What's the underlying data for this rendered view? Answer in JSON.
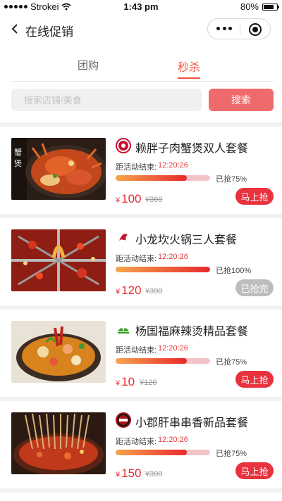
{
  "status_bar": {
    "carrier": "Strokei",
    "time": "1:43 pm",
    "battery": "80%",
    "battery_level": 0.8
  },
  "nav": {
    "title": "在线促销"
  },
  "tabs": [
    {
      "label": "团购"
    },
    {
      "label": "秒杀"
    }
  ],
  "active_tab": "秒杀",
  "search": {
    "placeholder": "搜索店铺/美食",
    "value": "",
    "button_label": "搜索"
  },
  "deals": [
    {
      "title": "赖胖子肉蟹煲双人套餐",
      "countdown_label": "距活动结束:",
      "countdown": "12:20:26",
      "progress": 0.75,
      "progress_text": "已抢75%",
      "currency": "¥",
      "price": "100",
      "original_price": "¥390",
      "button_label": "马上抢",
      "status": "active",
      "image_icon": "crab-pot-image",
      "logo_icon": "crab-restaurant-logo-icon",
      "accent": "#c8102e"
    },
    {
      "title": "小龙坎火锅三人套餐",
      "countdown_label": "距活动结束:",
      "countdown": "12:20:26",
      "progress": 1.0,
      "progress_text": "已抢100%",
      "currency": "¥",
      "price": "120",
      "original_price": "¥390",
      "button_label": "已抢完",
      "status": "sold_out",
      "image_icon": "hotpot-image",
      "logo_icon": "hotpot-restaurant-logo-icon",
      "accent": "#c8102e"
    },
    {
      "title": "杨国福麻辣烫精品套餐",
      "countdown_label": "距活动结束:",
      "countdown": "12:20:26",
      "progress": 0.75,
      "progress_text": "已抢75%",
      "currency": "¥",
      "price": "10",
      "original_price": "¥120",
      "button_label": "马上抢",
      "status": "active",
      "image_icon": "malatang-image",
      "logo_icon": "malatang-restaurant-logo-icon",
      "accent": "#3a9d23"
    },
    {
      "title": "小郡肝串串香新品套餐",
      "countdown_label": "距活动结束:",
      "countdown": "12:20:26",
      "progress": 0.75,
      "progress_text": "已抢75%",
      "currency": "¥",
      "price": "150",
      "original_price": "¥390",
      "button_label": "马上抢",
      "status": "active",
      "image_icon": "skewer-pot-image",
      "logo_icon": "skewer-restaurant-logo-icon",
      "accent": "#a31515"
    }
  ],
  "colors": {
    "accent": "#f5533d",
    "button_red": "#e8323e",
    "sold_gray": "#bdbdbd"
  }
}
